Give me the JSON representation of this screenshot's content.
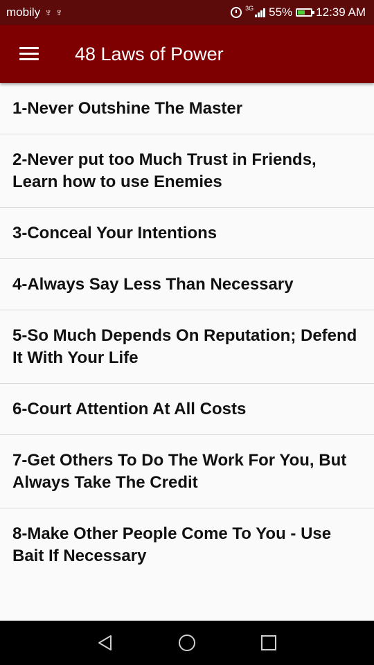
{
  "status_bar": {
    "carrier": "mobily",
    "usb_symbols": "♆ ♆",
    "network_type": "3G",
    "battery_percent": "55%",
    "battery_level": 0.55,
    "time": "12:39 AM"
  },
  "app_bar": {
    "title": "48 Laws of Power",
    "menu_icon": "hamburger-menu-icon",
    "color": "#7f0000"
  },
  "laws": [
    {
      "text": "1-Never Outshine The Master"
    },
    {
      "text": "2-Never put too Much Trust in Friends, Learn how to use Enemies"
    },
    {
      "text": "3-Conceal Your Intentions"
    },
    {
      "text": "4-Always Say Less Than Necessary"
    },
    {
      "text": "5-So Much Depends On Reputation; Defend It With Your Life"
    },
    {
      "text": "6-Court Attention At All Costs"
    },
    {
      "text": "7-Get Others To Do The Work For You, But Always Take The Credit"
    },
    {
      "text": "8-Make Other People Come To You - Use Bait If Necessary"
    }
  ],
  "nav_bar": {
    "icons": [
      "back-triangle-icon",
      "home-circle-icon",
      "recents-square-icon"
    ]
  }
}
